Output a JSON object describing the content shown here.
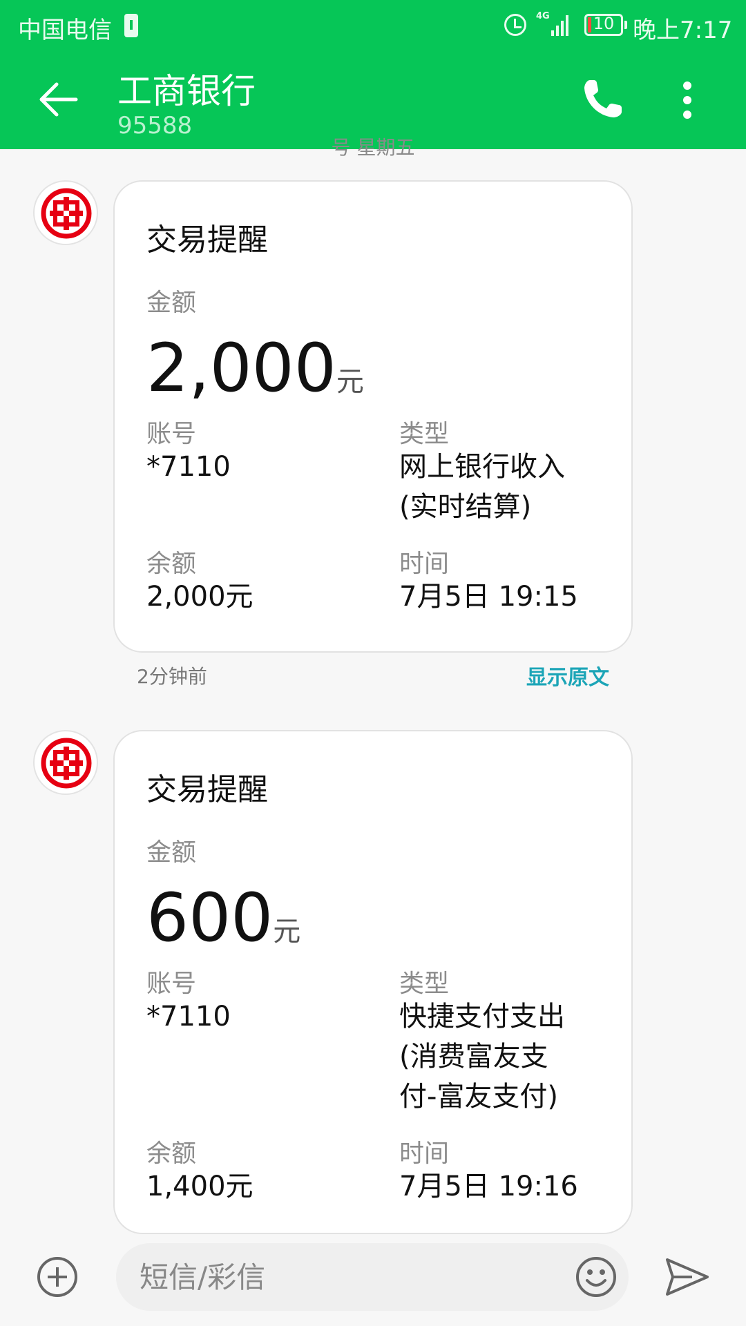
{
  "status_bar": {
    "carrier": "中国电信",
    "network": "4G",
    "battery": "10",
    "time": "晚上7:17",
    "battery_level": 0.1
  },
  "header": {
    "title": "工商银行",
    "subtitle": "95588"
  },
  "date_separator": "号 星期五",
  "messages": [
    {
      "title": "交易提醒",
      "amount_label": "金额",
      "amount": "2,000",
      "amount_unit": "元",
      "account_label": "账号",
      "account": "*7110",
      "type_label": "类型",
      "type": [
        "网上银行收入",
        "(实时结算)"
      ],
      "balance_label": "余额",
      "balance": "2,000元",
      "time_label": "时间",
      "time": "7月5日 19:15",
      "sent_ago": "2分钟前",
      "show_original": "显示原文"
    },
    {
      "title": "交易提醒",
      "amount_label": "金额",
      "amount": "600",
      "amount_unit": "元",
      "account_label": "账号",
      "account": "*7110",
      "type_label": "类型",
      "type": [
        "快捷支付支出",
        "(消费富友支",
        "付-富友支付)"
      ],
      "balance_label": "余额",
      "balance": "1,400元",
      "time_label": "时间",
      "time": "7月5日 19:16"
    }
  ],
  "composer": {
    "placeholder": "短信/彩信"
  },
  "colors": {
    "header": "#06c657",
    "link": "#1ca5b7",
    "bank_red": "#e60012"
  }
}
